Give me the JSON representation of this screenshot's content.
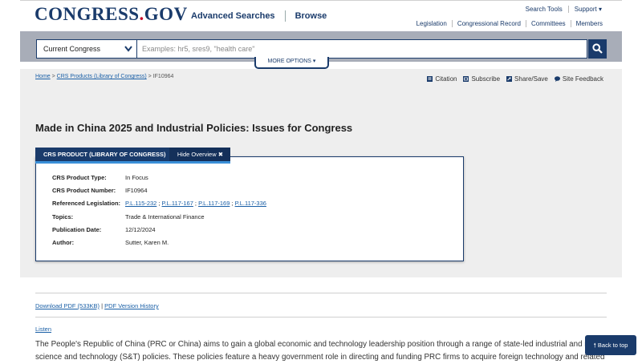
{
  "header": {
    "logo_main": "CONGRESS",
    "logo_dot": ".",
    "logo_suffix": "GOV",
    "nav": [
      "Advanced Searches",
      "Browse"
    ],
    "top_links": [
      "Search Tools",
      "Support ▾"
    ],
    "sub_links": [
      "Legislation",
      "Congressional Record",
      "Committees",
      "Members"
    ]
  },
  "search": {
    "scope_value": "Current Congress",
    "placeholder": "Examples: hr5, sres9, \"health care\"",
    "more_options": "MORE OPTIONS ▾"
  },
  "breadcrumb": {
    "home": "Home",
    "sep1": " > ",
    "crs": "CRS Products (Library of Congress)",
    "sep2": " > ",
    "current": "IF10964"
  },
  "tools": [
    "Citation",
    "Subscribe",
    "Share/Save",
    "Site Feedback"
  ],
  "page_title": "Made in China 2025 and Industrial Policies: Issues for Congress",
  "overview": {
    "tab_label": "CRS PRODUCT (LIBRARY OF CONGRESS)",
    "hide_label": "Hide Overview ✖",
    "rows": [
      {
        "key": "CRS Product Type:",
        "value": "In Focus"
      },
      {
        "key": "CRS Product Number:",
        "value": "IF10964"
      },
      {
        "key": "Referenced Legislation:",
        "value": ""
      },
      {
        "key": "Topics:",
        "value": "Trade & International Finance"
      },
      {
        "key": "Publication Date:",
        "value": "12/12/2024"
      },
      {
        "key": "Author:",
        "value": "Sutter, Karen M."
      }
    ],
    "legislation": [
      "P.L.115-232",
      "P.L.117-167",
      "P.L.117-169",
      "P.L.117-336"
    ],
    "leg_sep": ";"
  },
  "links": {
    "pdf": "Download PDF (533KB)",
    "divider": " | ",
    "pdf_version": "PDF Version History",
    "listen": "Listen"
  },
  "body": {
    "line1": "The People's Republic of China (PRC or China) aims to gain a global economic and technology leadership position through a range of state-led industrial and related",
    "line2": "science and technology (S&T) policies. These policies feature a heavy government role in directing and funding PRC firms to acquire foreign technology and related"
  },
  "back_to_top": "Back to top",
  "colors": {
    "navy": "#1a3b6b",
    "accent_red": "#c8102e",
    "link_blue": "#1a5fa6",
    "band_gray": "#a8adb8",
    "content_gray": "#eeeeee"
  }
}
